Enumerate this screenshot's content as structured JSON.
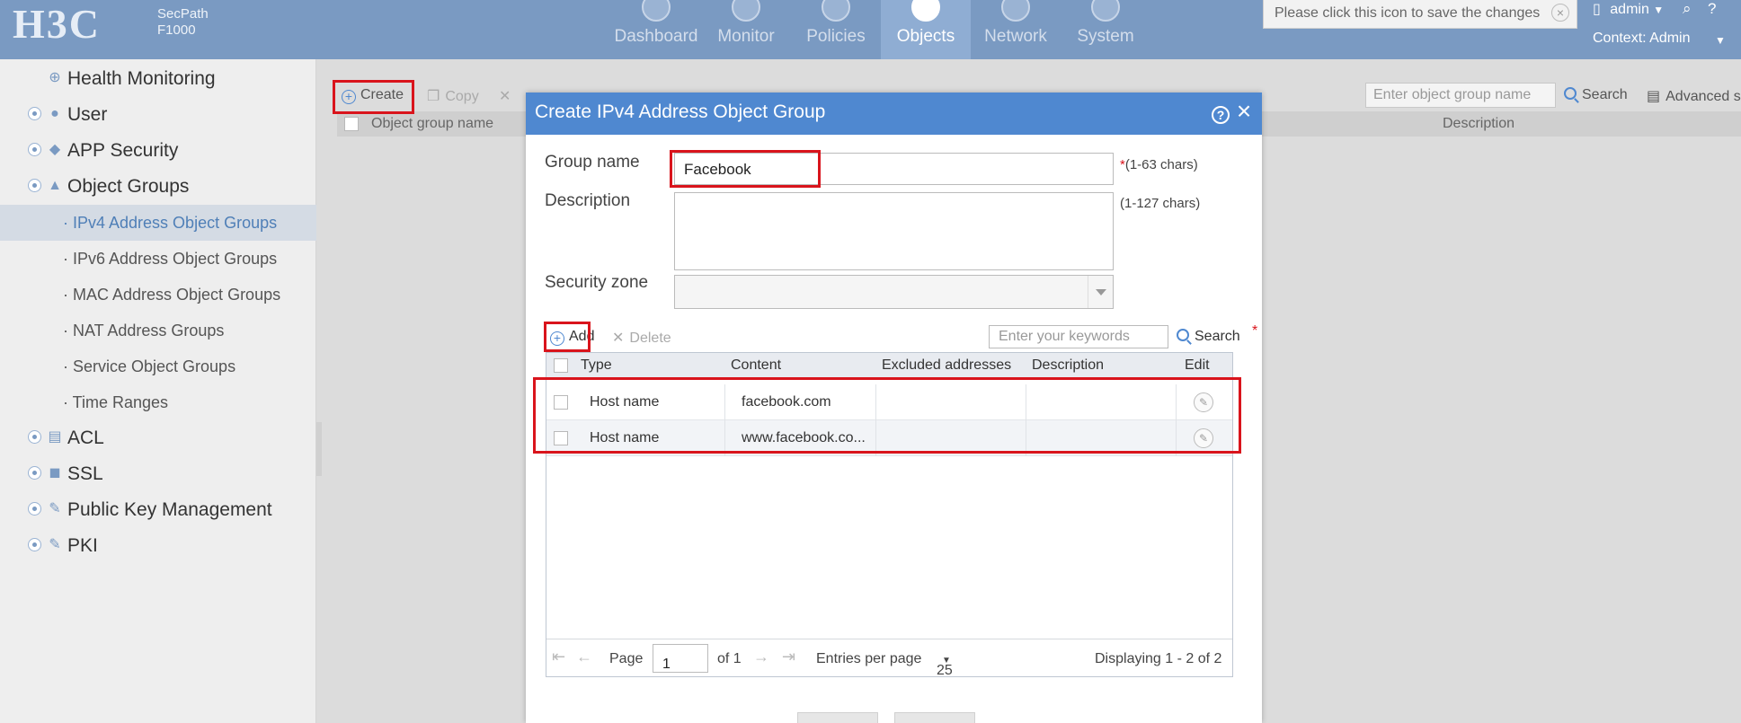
{
  "header": {
    "logo": "H3C",
    "product_line1": "SecPath",
    "product_line2": "F1000",
    "nav": [
      {
        "label": "Dashboard",
        "icon": "dashboard-icon"
      },
      {
        "label": "Monitor",
        "icon": "monitor-icon"
      },
      {
        "label": "Policies",
        "icon": "shield-icon"
      },
      {
        "label": "Objects",
        "icon": "share-icon",
        "active": true
      },
      {
        "label": "Network",
        "icon": "globe-icon"
      },
      {
        "label": "System",
        "icon": "computer-icon"
      }
    ],
    "tooltip": "Please click this icon to save the changes",
    "user": "admin",
    "context": "Context: Admin"
  },
  "sidebar": {
    "items": [
      {
        "label": "Health Monitoring",
        "icon": "health-icon"
      },
      {
        "label": "User",
        "icon": "user-icon"
      },
      {
        "label": "APP Security",
        "icon": "app-security-icon"
      },
      {
        "label": "Object Groups",
        "icon": "object-groups-icon"
      }
    ],
    "sub_items": [
      {
        "label": "IPv4 Address Object Groups",
        "active": true
      },
      {
        "label": "IPv6 Address Object Groups"
      },
      {
        "label": "MAC Address Object Groups"
      },
      {
        "label": "NAT Address Groups"
      },
      {
        "label": "Service Object Groups"
      },
      {
        "label": "Time Ranges"
      }
    ],
    "items_after": [
      {
        "label": "ACL",
        "icon": "acl-icon"
      },
      {
        "label": "SSL",
        "icon": "ssl-icon"
      },
      {
        "label": "Public Key Management",
        "icon": "key-icon"
      },
      {
        "label": "PKI",
        "icon": "pki-icon"
      }
    ]
  },
  "main": {
    "toolbar": {
      "create": "Create",
      "copy": "Copy",
      "search_placeholder": "Enter object group name",
      "search": "Search",
      "advanced": "Advanced s"
    },
    "grid_headers": {
      "name": "Object group name",
      "description": "Description"
    }
  },
  "modal": {
    "title": "Create IPv4 Address Object Group",
    "group_name_label": "Group name",
    "group_name_value": "Facebook",
    "group_name_hint": "(1-63 chars)",
    "description_label": "Description",
    "description_hint": "(1-127 chars)",
    "security_zone_label": "Security zone",
    "add": "Add",
    "delete": "Delete",
    "keyword_placeholder": "Enter your keywords",
    "search": "Search",
    "columns": [
      "Type",
      "Content",
      "Excluded addresses",
      "Description",
      "Edit"
    ],
    "rows": [
      {
        "type": "Host name",
        "content": "facebook.com",
        "excluded": "",
        "description": ""
      },
      {
        "type": "Host name",
        "content": "www.facebook.co...",
        "excluded": "",
        "description": ""
      }
    ],
    "pager": {
      "page_label": "Page",
      "page_value": "1",
      "of_label": "of 1",
      "entries_label": "Entries per page",
      "entries_value": "25",
      "displaying": "Displaying 1 - 2 of 2"
    }
  },
  "colors": {
    "header": "#7a9ac2",
    "accent": "#4f88d0",
    "highlight": "#d9141c"
  }
}
